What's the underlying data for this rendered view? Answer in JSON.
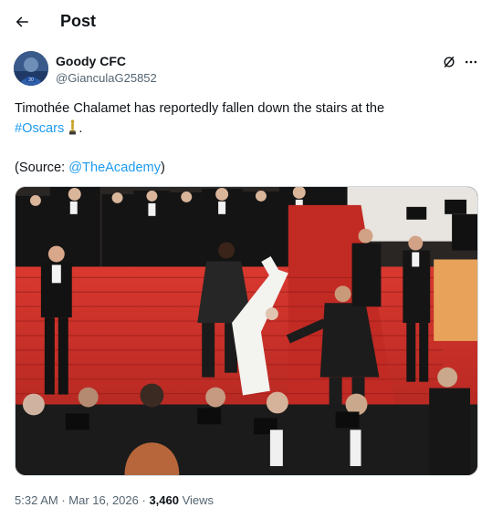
{
  "header": {
    "title": "Post",
    "back_icon": "arrow-left-icon"
  },
  "author": {
    "name": "Goody CFC",
    "handle": "@GianculaG25852",
    "avatar_icon": "avatar-image"
  },
  "actions": {
    "grok_icon": "grok-icon",
    "more_icon": "more-horizontal-icon"
  },
  "tweet": {
    "line1": "Timothée Chalamet has reportedly fallen down the stairs at the",
    "hashtag": "#Oscars",
    "line2_suffix": ".",
    "emoji_icon": "oscar-trophy-icon",
    "source_prefix": "(Source: ",
    "mention": "@TheAcademy",
    "source_suffix": ")"
  },
  "media": {
    "type": "photo",
    "subject_icon": "red-carpet-stairs-photo"
  },
  "meta": {
    "time": "5:32 AM",
    "separator1": " · ",
    "date": "Mar 16, 2026",
    "separator2": " · ",
    "views_count": "3,460",
    "views_label": " Views"
  },
  "colors": {
    "link": "#1d9bf0",
    "text": "#0f1419",
    "secondary": "#536471",
    "border": "#cfd9de",
    "carpet": "#c9302c"
  }
}
